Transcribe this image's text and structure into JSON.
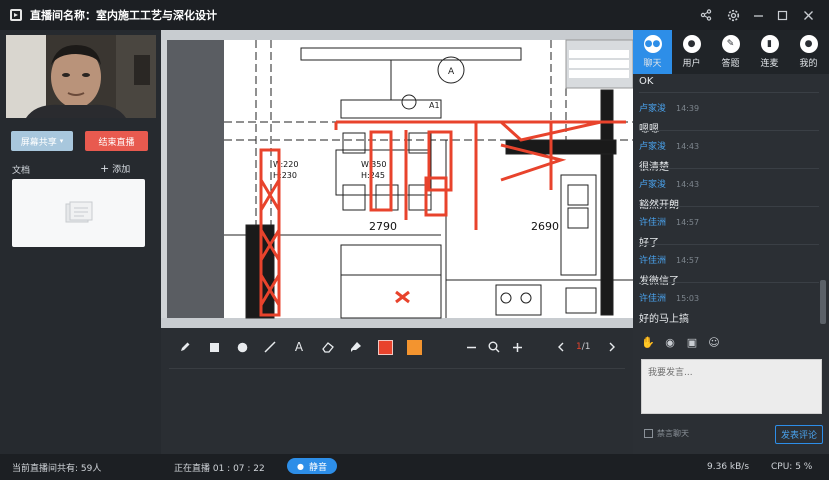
{
  "window": {
    "title": "直播间名称：室内施工工艺与深化设计",
    "controls": [
      "share-icon",
      "gear-icon",
      "minimize-icon",
      "maximize-icon",
      "close-icon"
    ]
  },
  "left": {
    "screen_share_label": "屏幕共享",
    "end_live_label": "结束直播",
    "docs_label": "文档",
    "add_label": "添加"
  },
  "canvas": {
    "drawing_labels": {
      "dim_left": "2790",
      "dim_right": "2690",
      "w_h_left_w": "W:220",
      "w_h_left_h": "H:230",
      "w_h_mid_w": "W:350",
      "w_h_mid_h": "H:245",
      "circle_a1": "A",
      "circle_a2": "A1"
    }
  },
  "toolbar": {
    "tools": [
      "pen-icon",
      "rectangle-icon",
      "circle-icon",
      "line-icon",
      "text-icon",
      "eraser-icon",
      "clear-icon"
    ],
    "text_tool": "A",
    "color_red": "#e8432c",
    "color_orange": "#f3942f",
    "page_current": "1",
    "page_total": "/1"
  },
  "right": {
    "tabs": [
      {
        "label": "聊天",
        "icon": "chat-icon",
        "active": true
      },
      {
        "label": "用户",
        "icon": "users-icon",
        "active": false
      },
      {
        "label": "答题",
        "icon": "quiz-icon",
        "active": false
      },
      {
        "label": "连麦",
        "icon": "mic-icon",
        "active": false
      },
      {
        "label": "我的",
        "icon": "profile-icon",
        "active": false
      }
    ],
    "messages": [
      {
        "user": "",
        "time": "",
        "text": "OK"
      },
      {
        "user": "卢家浚",
        "time": "14:39",
        "text": "嗯嗯"
      },
      {
        "user": "卢家浚",
        "time": "14:43",
        "text": "很清楚"
      },
      {
        "user": "卢家浚",
        "time": "14:43",
        "text": "豁然开朗"
      },
      {
        "user": "许佳洲",
        "time": "14:57",
        "text": "好了"
      },
      {
        "user": "许佳洲",
        "time": "14:57",
        "text": "发微信了"
      },
      {
        "user": "许佳洲",
        "time": "15:03",
        "text": "好的马上搞"
      }
    ],
    "input_placeholder": "我要发言...",
    "mute_chat_label": "禁言聊天",
    "send_label": "发表评论"
  },
  "status": {
    "online_count": "当前直播间共有: 59人",
    "live_time": "正在直播 01 : 07 : 22",
    "mute_label": "静音",
    "bandwidth": "9.36 kB/s",
    "cpu": "CPU:  5 %"
  },
  "colors": {
    "accent": "#2d8ee8",
    "end_red": "#e85a4f",
    "share_blue": "#a8c7dd"
  }
}
